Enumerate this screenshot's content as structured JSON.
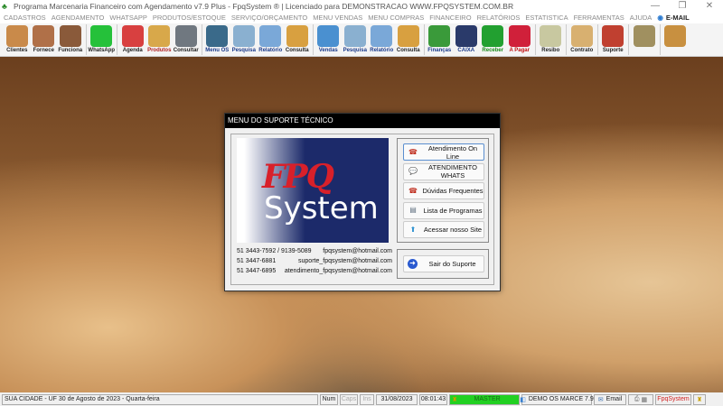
{
  "window": {
    "title": "Programa Marcenaria Financeiro com Agendamento v7.9 Plus - FpqSystem ® | Licenciado para  DEMONSTRACAO WWW.FPQSYSTEM.COM.BR"
  },
  "menu": [
    "CADASTROS",
    "AGENDAMENTO",
    "WHATSAPP",
    "PRODUTOS/ESTOQUE",
    "SERVIÇO/ORÇAMENTO",
    "MENU VENDAS",
    "MENU COMPRAS",
    "FINANCEIRO",
    "RELATÓRIOS",
    "ESTATISTICA",
    "FERRAMENTAS",
    "AJUDA"
  ],
  "menu_email": "E-MAIL",
  "toolbar": [
    {
      "label": "Clientes",
      "icon": "clients-icon",
      "color": "#c98a4a",
      "labelColor": "#222"
    },
    {
      "label": "Fornece",
      "icon": "supplier-icon",
      "color": "#b07048",
      "labelColor": "#222"
    },
    {
      "label": "Funciona",
      "icon": "employee-icon",
      "color": "#8a5a3a",
      "labelColor": "#222",
      "sep": true
    },
    {
      "label": "WhatsApp",
      "icon": "whatsapp-icon",
      "color": "#25c13a",
      "labelColor": "#222",
      "sep": true
    },
    {
      "label": "Agenda",
      "icon": "calendar-icon",
      "color": "#d84040",
      "labelColor": "#222"
    },
    {
      "label": "Produtos",
      "icon": "boxes-icon",
      "color": "#d8a84a",
      "labelColor": "#b02020"
    },
    {
      "label": "Consultar",
      "icon": "barcode-icon",
      "color": "#707880",
      "labelColor": "#222",
      "sep": true
    },
    {
      "label": "Menu OS",
      "icon": "clipboard-icon",
      "color": "#3a6a8a",
      "labelColor": "#1a3a8a"
    },
    {
      "label": "Pesquisa",
      "icon": "search-docs-icon",
      "color": "#8ab0d0",
      "labelColor": "#1a3a8a"
    },
    {
      "label": "Relatório",
      "icon": "printer-icon",
      "color": "#7aa8d8",
      "labelColor": "#1a3a8a"
    },
    {
      "label": "Consulta",
      "icon": "drawer-icon",
      "color": "#d8a040",
      "labelColor": "#222",
      "sep": true
    },
    {
      "label": "Vendas",
      "icon": "monitor-icon",
      "color": "#4a90d0",
      "labelColor": "#1a3a8a"
    },
    {
      "label": "Pesquisa",
      "icon": "search-docs-icon",
      "color": "#8ab0d0",
      "labelColor": "#1a3a8a"
    },
    {
      "label": "Relatório",
      "icon": "printer-icon",
      "color": "#7aa8d8",
      "labelColor": "#1a3a8a"
    },
    {
      "label": "Consulta",
      "icon": "drawer-icon",
      "color": "#d8a040",
      "labelColor": "#222",
      "sep": true
    },
    {
      "label": "Finanças",
      "icon": "finance-chart-icon",
      "color": "#3a9a3a",
      "labelColor": "#1a3a8a"
    },
    {
      "label": "CAIXA",
      "icon": "cashbook-icon",
      "color": "#2a3a6a",
      "labelColor": "#1a3a8a"
    },
    {
      "label": "Receber",
      "icon": "dollar-green-icon",
      "color": "#22a030",
      "labelColor": "#1a8a1a"
    },
    {
      "label": "A Pagar",
      "icon": "dollar-red-icon",
      "color": "#d0203a",
      "labelColor": "#c01010",
      "sep": true
    },
    {
      "label": "Resibo",
      "icon": "receipt-icon",
      "color": "#c8c8a0",
      "labelColor": "#222",
      "sep": true
    },
    {
      "label": "Contrato",
      "icon": "contract-icon",
      "color": "#d8b070",
      "labelColor": "#222",
      "sep": true
    },
    {
      "label": "Suporte",
      "icon": "support-icon",
      "color": "#c04030",
      "labelColor": "#222",
      "sep": true
    },
    {
      "label": "",
      "icon": "coin-icon",
      "color": "#a09060",
      "labelColor": "#222",
      "sep": true
    },
    {
      "label": "",
      "icon": "exit-door-icon",
      "color": "#c89040",
      "labelColor": "#222"
    }
  ],
  "dialog": {
    "title": "MENU DO SUPORTE TÉCNICO",
    "logo_text": [
      "FPQ",
      "System"
    ],
    "contacts": [
      {
        "phone": "51 3443-7592 / 9139-5089",
        "email": "fpqsystem@hotmail.com"
      },
      {
        "phone": "51 3447-6881",
        "email": "suporte_fpqsystem@hotmail.com"
      },
      {
        "phone": "51 3447-6895",
        "email": "atendimento_fpqsystem@hotmail.com"
      }
    ],
    "buttons": [
      {
        "label": "Atendimento On Line",
        "icon": "support-agent-icon",
        "glyph": "☎",
        "color": "#c03020"
      },
      {
        "label": "ATENDIMENTO WHATS",
        "icon": "chat-bubble-icon",
        "glyph": "💬",
        "color": "#3a80d0"
      },
      {
        "label": "Dúvidas Frequentes",
        "icon": "support-agent-icon",
        "glyph": "☎",
        "color": "#c03020"
      },
      {
        "label": "Lista de Programas",
        "icon": "program-list-icon",
        "glyph": "▤",
        "color": "#607080"
      },
      {
        "label": "Acessar nosso Site",
        "icon": "arrow-up-circle-icon",
        "glyph": "⬆",
        "color": "#2a90d0"
      }
    ],
    "exit_button": {
      "label": "Sair do Suporte",
      "glyph": "➜"
    }
  },
  "status": {
    "location_date": "SUA CIDADE - UF 30 de Agosto de 2023 - Quarta-feira",
    "num": "Num",
    "caps": "Caps",
    "ins": "Ins",
    "date": "31/08/2023",
    "time": "08:01:43",
    "user": "MASTER",
    "version": "DEMO OS MARCE 7.9",
    "email": "Email",
    "brand": "FpqSystem"
  }
}
